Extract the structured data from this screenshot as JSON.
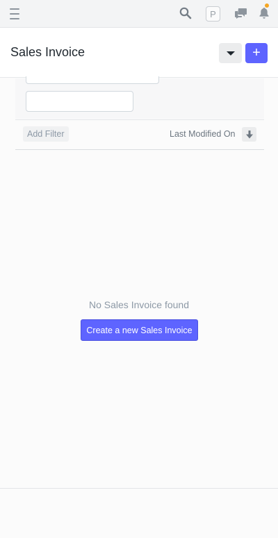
{
  "navbar": {
    "menu_icon": "hamburger-icon",
    "search_icon": "search-icon",
    "avatar_initial": "P",
    "chat_icon": "chat-icon",
    "notification_icon": "bell-icon",
    "notification_dot_color": "#f5a623"
  },
  "header": {
    "title": "Sales Invoice",
    "menu_icon": "caret-down-icon",
    "add_label": "+"
  },
  "filters": {
    "add_filter_label": "Add Filter",
    "sort_label": "Last Modified On",
    "sort_icon": "arrow-down-icon"
  },
  "empty_state": {
    "message": "No Sales Invoice found",
    "create_label": "Create a new Sales Invoice"
  },
  "colors": {
    "primary": "#5e64ff",
    "text": "#1f272e",
    "muted": "#8d99a6"
  }
}
